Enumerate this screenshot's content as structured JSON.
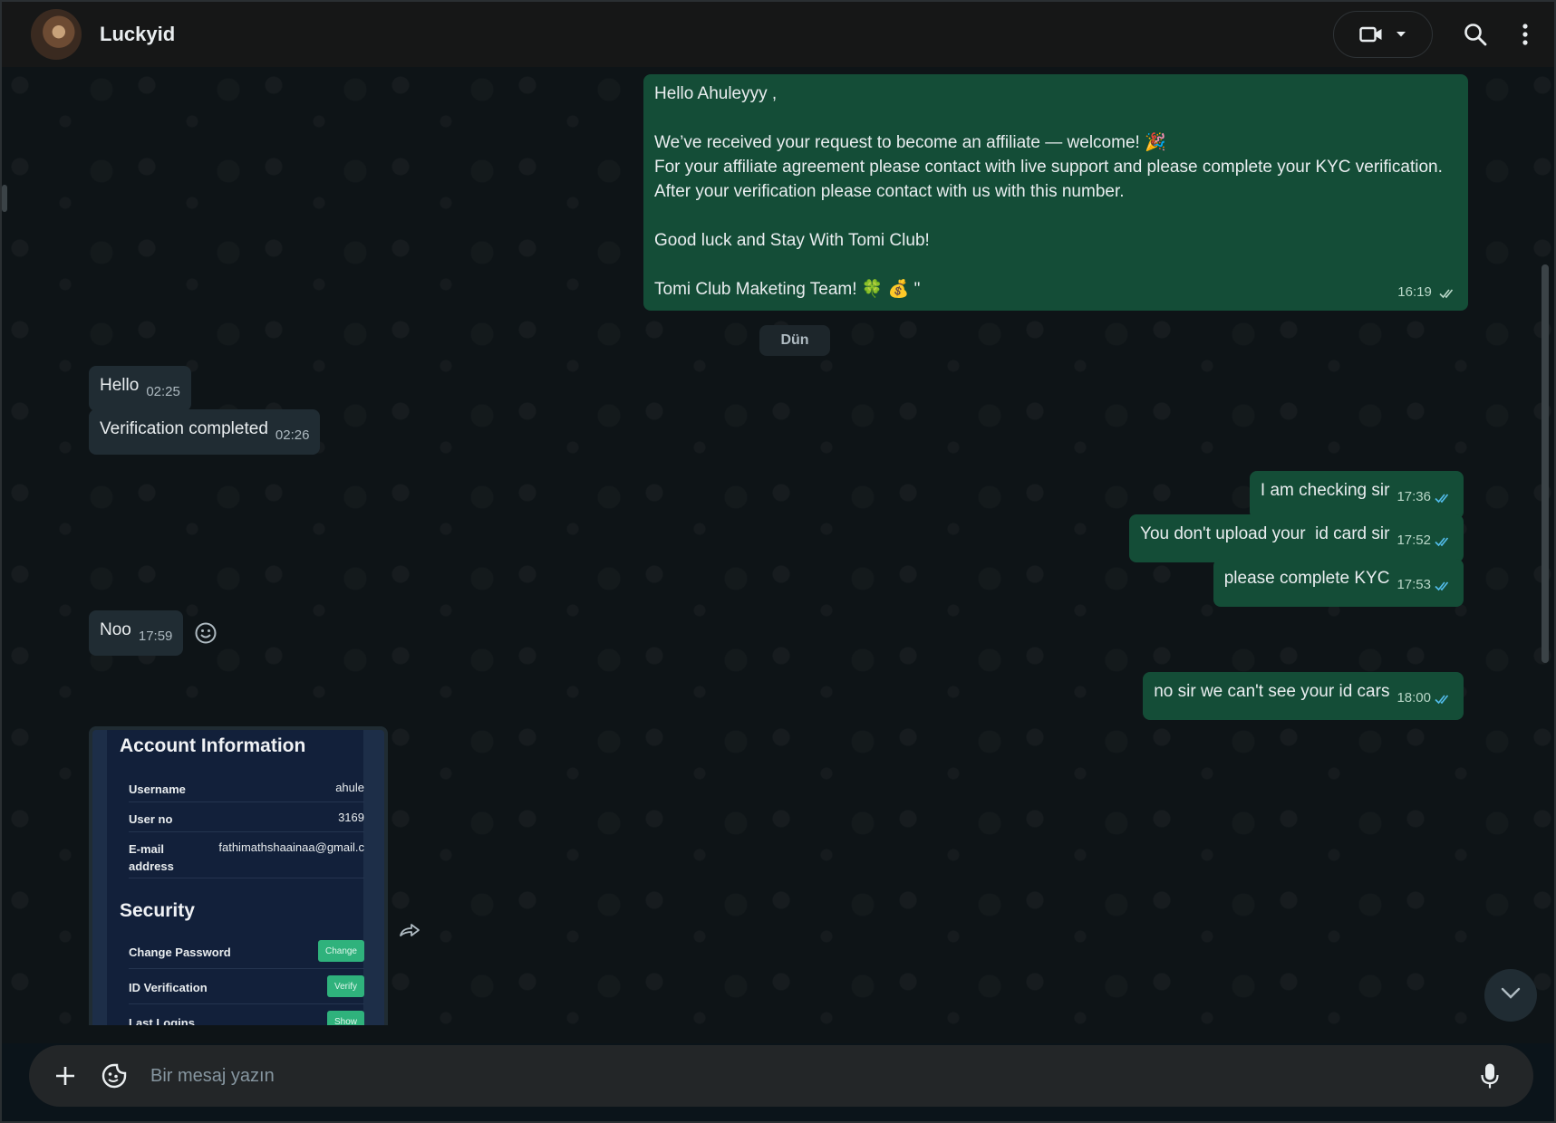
{
  "header": {
    "contact_name": "Luckyid"
  },
  "messages": {
    "welcome": {
      "lines": [
        "Hello Ahuleyyy ,",
        "",
        "We’ve received your request to become an affiliate — welcome! 🎉",
        "For your affiliate agreement please contact with live support and please complete your KYC verification.",
        "After your verification please contact with us with this number.",
        "",
        "Good luck and Stay With Tomi Club!",
        "",
        "Tomi Club Maketing Team! 🍀 💰 \""
      ],
      "time": "16:19"
    },
    "date_separator": "Dün",
    "hello": {
      "text": "Hello",
      "time": "02:25"
    },
    "verification": {
      "text": "Verification completed",
      "time": "02:26"
    },
    "checking": {
      "text": "I am checking sir",
      "time": "17:36"
    },
    "no_upload": {
      "text": "You don't upload your  id card sir",
      "time": "17:52"
    },
    "complete_kyc": {
      "text": "please complete KYC",
      "time": "17:53"
    },
    "noo": {
      "text": "Noo",
      "time": "17:59"
    },
    "cant_see": {
      "text": "no sir we can't see your id cars",
      "time": "18:00"
    }
  },
  "screenshot": {
    "account_title": "Account Information",
    "rows": [
      {
        "label": "Username",
        "value": "ahule"
      },
      {
        "label": "User no",
        "value": "3169"
      },
      {
        "label": "E-mail address",
        "value": "fathimathshaainaa@gmail.c"
      }
    ],
    "security_title": "Security",
    "security_rows": [
      {
        "label": "Change Password",
        "button": "Change"
      },
      {
        "label": "ID Verification",
        "button": "Verify"
      },
      {
        "label": "Last Logins",
        "button": "Show"
      }
    ]
  },
  "composer": {
    "placeholder": "Bir mesaj yazın"
  },
  "colors": {
    "incoming_bubble": "#202c33",
    "outgoing_bubble": "#144d37",
    "read_ticks": "#53bdeb",
    "accent_button": "#2fb27c"
  },
  "icons": [
    "video-call-icon",
    "chevron-down-icon",
    "search-icon",
    "more-vertical-icon",
    "emoji-react-icon",
    "forward-icon",
    "plus-icon",
    "sticker-icon",
    "microphone-icon",
    "double-check-icon"
  ]
}
